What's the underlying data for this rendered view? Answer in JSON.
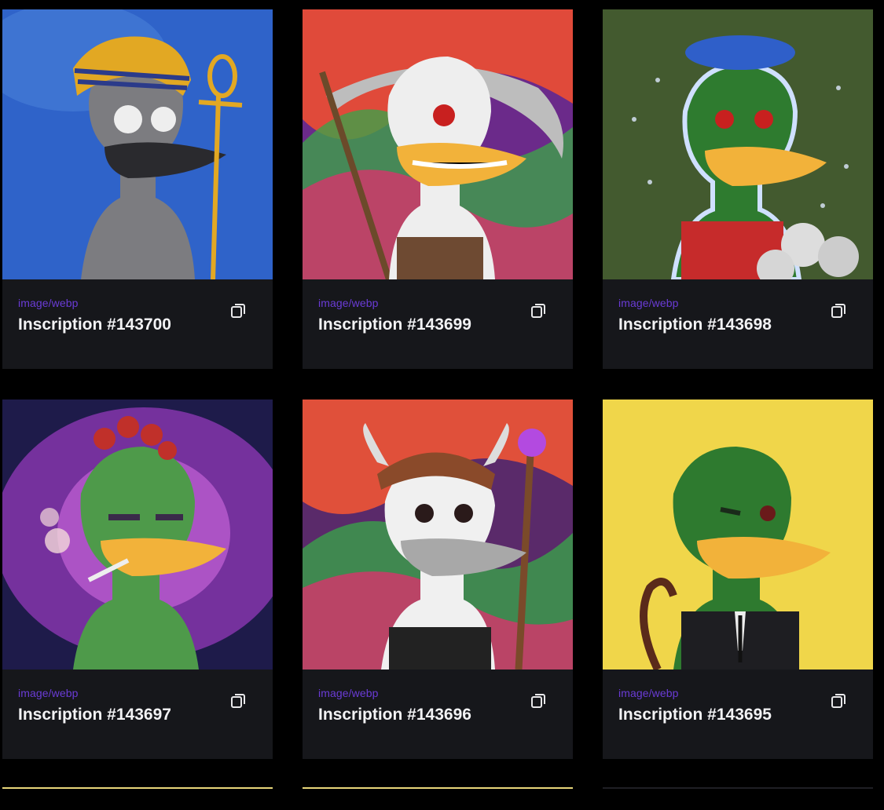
{
  "cards": [
    {
      "mime": "image/webp",
      "title": "Inscription #143700",
      "art": "pharaoh-duck"
    },
    {
      "mime": "image/webp",
      "title": "Inscription #143699",
      "art": "reaper-duck"
    },
    {
      "mime": "image/webp",
      "title": "Inscription #143698",
      "art": "beret-duck"
    },
    {
      "mime": "image/webp",
      "title": "Inscription #143697",
      "art": "mushroom-duck"
    },
    {
      "mime": "image/webp",
      "title": "Inscription #143696",
      "art": "viking-duck"
    },
    {
      "mime": "image/webp",
      "title": "Inscription #143695",
      "art": "suit-duck"
    }
  ],
  "icons": {
    "copy": "copy-icon"
  },
  "colors": {
    "mime": "#6a3bd6",
    "card_bg": "#16171b",
    "page_bg": "#000000",
    "accent_line": "#e8d67a"
  }
}
